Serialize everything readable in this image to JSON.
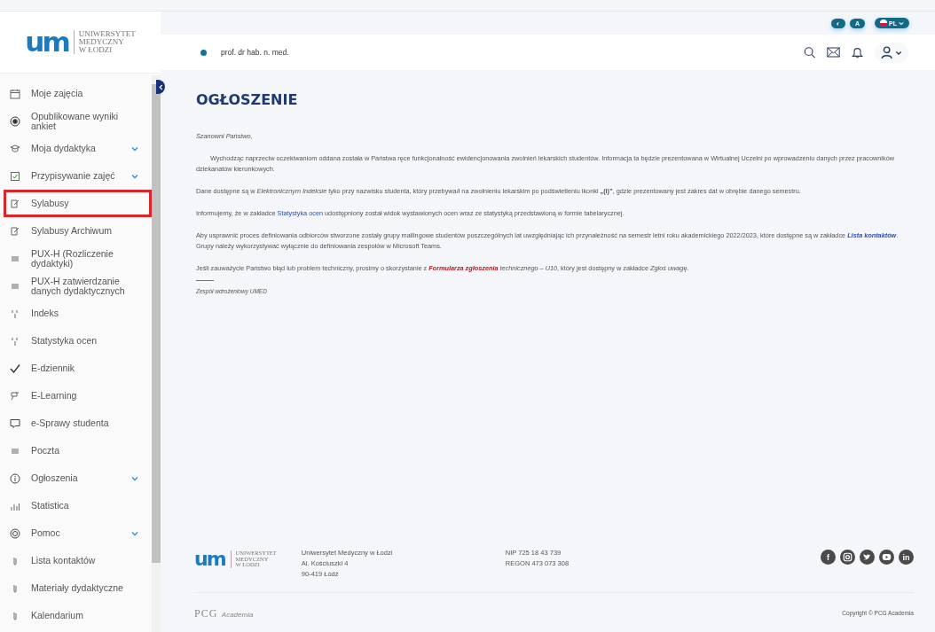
{
  "logo": {
    "mark": "um",
    "lines": [
      "UNIWERSYTET",
      "MEDYCZNY",
      "W ŁODZI"
    ]
  },
  "toolbar": {
    "contrast": "◐",
    "font": "A",
    "language": "PL"
  },
  "header": {
    "user_title": "prof. dr hab. n. med."
  },
  "sidebar": {
    "items": [
      {
        "label": "Moje zajęcia",
        "kind": "calendar",
        "submenu": false,
        "highlighted": false
      },
      {
        "label": "Opublikowane wyniki ankiet",
        "kind": "radio",
        "submenu": false,
        "highlighted": false
      },
      {
        "label": "Moja dydaktyka",
        "kind": "cap",
        "submenu": true,
        "highlighted": false
      },
      {
        "label": "Przypisywanie zajęć",
        "kind": "checkbox",
        "submenu": true,
        "highlighted": false
      },
      {
        "label": "Sylabusy",
        "kind": "edit",
        "submenu": false,
        "highlighted": true
      },
      {
        "label": "Sylabusy Archiwum",
        "kind": "edit",
        "submenu": false,
        "highlighted": false
      },
      {
        "label": "PUX-H (Rozliczenie dydaktyki)",
        "kind": "lines",
        "submenu": false,
        "highlighted": false
      },
      {
        "label": "PUX-H zatwierdzanie danych dydaktycznych",
        "kind": "lines",
        "submenu": false,
        "highlighted": false
      },
      {
        "label": "Indeks",
        "kind": "fraction",
        "submenu": false,
        "highlighted": false
      },
      {
        "label": "Statystyka ocen",
        "kind": "fraction",
        "submenu": false,
        "highlighted": false
      },
      {
        "label": "E-dziennik",
        "kind": "check",
        "submenu": false,
        "highlighted": false
      },
      {
        "label": "E-Learning",
        "kind": "screen",
        "submenu": false,
        "highlighted": false
      },
      {
        "label": "e-Sprawy studenta",
        "kind": "chat",
        "submenu": false,
        "highlighted": false
      },
      {
        "label": "Poczta",
        "kind": "lines",
        "submenu": false,
        "highlighted": false
      },
      {
        "label": "Ogłoszenia",
        "kind": "info",
        "submenu": true,
        "highlighted": false
      },
      {
        "label": "Statistica",
        "kind": "bars",
        "submenu": false,
        "highlighted": false
      },
      {
        "label": "Pomoc",
        "kind": "ring",
        "submenu": true,
        "highlighted": false
      },
      {
        "label": "Lista kontaktów",
        "kind": "clip",
        "submenu": false,
        "highlighted": false
      },
      {
        "label": "Materiały dydaktyczne",
        "kind": "clip",
        "submenu": false,
        "highlighted": false
      },
      {
        "label": "Kalendarium",
        "kind": "clip",
        "submenu": false,
        "highlighted": false
      }
    ]
  },
  "announcement": {
    "title": "OGŁOSZENIE",
    "greeting": "Szanowni Państwo,",
    "paragraphs": [
      {
        "indent": true,
        "parts": [
          {
            "kind": "text",
            "text": "Wychodząc naprzeciw oczekiwaniom oddana została w Państwa ręce funkcjonalność ewidencjonowania zwolnień lekarskich studentów. Informacja ta będzie prezentowana w Wirtualnej Uczelni po wprowadzeniu danych przez pracowników dziekanatów kierunkowych."
          }
        ]
      },
      {
        "indent": false,
        "parts": [
          {
            "kind": "text",
            "text": "Dane dostępne są w *Elektronicznym Indeksie* tyko przy nazwisku studenta, który przebywa/ł na zwolnieniu lekarskim po podświetleniu ikonki **„(i)”**, gdzie prezentowany jest zakres dat w obrębie danego semestru."
          }
        ]
      },
      {
        "indent": false,
        "parts": [
          {
            "kind": "text",
            "text": "Informujemy, że w zakładce "
          },
          {
            "kind": "link",
            "text": "Statystyka ocen"
          },
          {
            "kind": "text",
            "text": " udostępniony został widok wystawionych ocen wraz ze statystyką przedstawioną w formie tabelarycznej."
          }
        ]
      },
      {
        "indent": false,
        "parts": [
          {
            "kind": "text",
            "text": "Aby usprawnić proces definiowania odbiorców stworzone zostały grupy mailingowe studentów poszczególnych lat uwzględniając ich przynależność na semestr letni roku akademickiego 2022/2023, które dostępne są w zakładce "
          },
          {
            "kind": "italic-link",
            "text": "Lista kontaktów"
          },
          {
            "kind": "text",
            "text": ". Grupy należy wykorzystywać wyłącznie do definiowania zespołów w Microsoft Teams."
          }
        ]
      },
      {
        "indent": false,
        "parts": [
          {
            "kind": "text",
            "text": "Jeśli zauważycie Państwo błąd lub problem techniczny, prosimy o skorzystanie z "
          },
          {
            "kind": "alert-link",
            "text": "Formularza zgłoszenia"
          },
          {
            "kind": "text",
            "text": " *technicznego – U10*, który jest dostępny w zakładce *Zgłoś uwagę*."
          }
        ]
      }
    ],
    "signature": "Zespół wdrożeniowy UMED"
  },
  "footer": {
    "logo": {
      "mark": "um",
      "lines": [
        "UNIWERSYTET",
        "MEDYCZNY",
        "W ŁODZI"
      ]
    },
    "address": [
      "Uniwersytet Medyczny w Łodzi",
      "Al. Kościuszki 4",
      "90-419 Łódź"
    ],
    "registry": [
      "NIP 725 18 43 739",
      "REGON 473 073 308"
    ],
    "social": [
      {
        "kind": "letter",
        "text": "f"
      },
      {
        "kind": "camera"
      },
      {
        "kind": "bird"
      },
      {
        "kind": "play"
      },
      {
        "kind": "letter",
        "text": "in"
      }
    ],
    "brand": {
      "mark": "PCG",
      "name": "Academia"
    },
    "copyright": "Copyright © PCG Academia"
  }
}
